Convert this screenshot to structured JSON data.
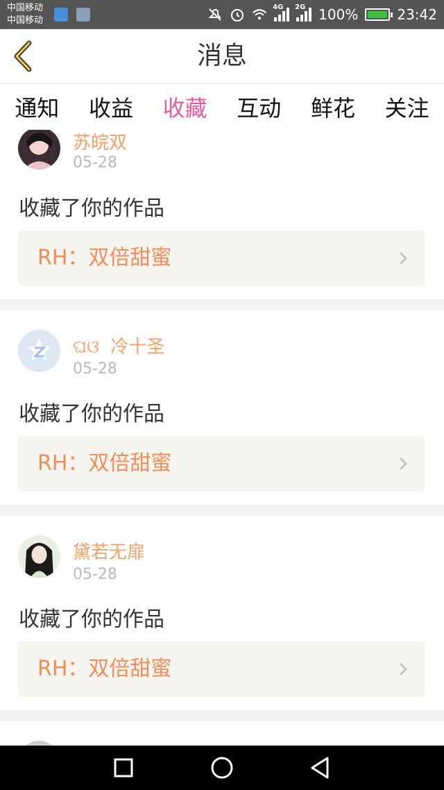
{
  "status_bar": {
    "carrier_1": "中国移动",
    "carrier_2": "中国移动",
    "network_1": "4G",
    "network_2": "2G",
    "battery": "100%",
    "time": "23:42"
  },
  "header": {
    "title": "消息"
  },
  "tabs": [
    {
      "label": "通知",
      "active": false
    },
    {
      "label": "收益",
      "active": false
    },
    {
      "label": "收藏",
      "active": true
    },
    {
      "label": "互动",
      "active": false
    },
    {
      "label": "鲜花",
      "active": false
    },
    {
      "label": "关注",
      "active": false
    }
  ],
  "messages": [
    {
      "name": "苏皖双",
      "date": "05-28",
      "action": "收藏了你的作品",
      "work": "RH：双倍甜蜜"
    },
    {
      "name": "冷十圣",
      "name_prefix": "ଘଓ",
      "date": "05-28",
      "action": "收藏了你的作品",
      "work": "RH：双倍甜蜜"
    },
    {
      "name": "黛若无扉",
      "date": "05-28",
      "action": "收藏了你的作品",
      "work": "RH：双倍甜蜜"
    }
  ],
  "colors": {
    "accent": "#e55a9c",
    "name": "#f1a06a",
    "work_title": "#f08d58",
    "work_bg": "#f5f4ee"
  },
  "icons": {
    "back": "chevron-left-icon",
    "work_arrow": "chevron-right-icon",
    "nav": [
      "recents-square-icon",
      "home-circle-icon",
      "back-triangle-icon"
    ]
  }
}
